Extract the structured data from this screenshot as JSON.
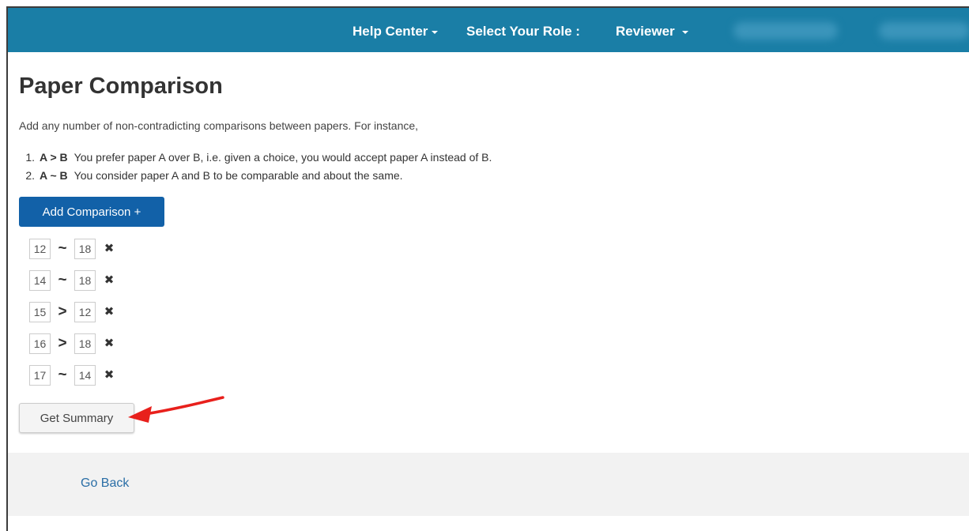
{
  "navbar": {
    "help_center": "Help Center",
    "role_label": "Select Your Role :",
    "role_value": "Reviewer"
  },
  "page": {
    "title": "Paper Comparison",
    "intro": "Add any number of non-contradicting comparisons between papers. For instance,",
    "rules": [
      {
        "num": "1.",
        "expr": "A > B",
        "text": "You prefer paper A over B, i.e. given a choice, you would accept paper A instead of B."
      },
      {
        "num": "2.",
        "expr": "A ~ B",
        "text": "You consider paper A and B to be comparable and about the same."
      }
    ]
  },
  "buttons": {
    "add_comparison": "Add Comparison +",
    "get_summary": "Get Summary",
    "remove_glyph": "✖"
  },
  "comparisons": [
    {
      "a": "12",
      "op": "~",
      "b": "18"
    },
    {
      "a": "14",
      "op": "~",
      "b": "18"
    },
    {
      "a": "15",
      "op": ">",
      "b": "12"
    },
    {
      "a": "16",
      "op": ">",
      "b": "18"
    },
    {
      "a": "17",
      "op": "~",
      "b": "14"
    }
  ],
  "footer": {
    "go_back": "Go Back"
  },
  "colors": {
    "navbar": "#1a7ea6",
    "primary_button": "#1261a8",
    "link": "#2a6ea6",
    "annotation_arrow": "#e8201c"
  }
}
